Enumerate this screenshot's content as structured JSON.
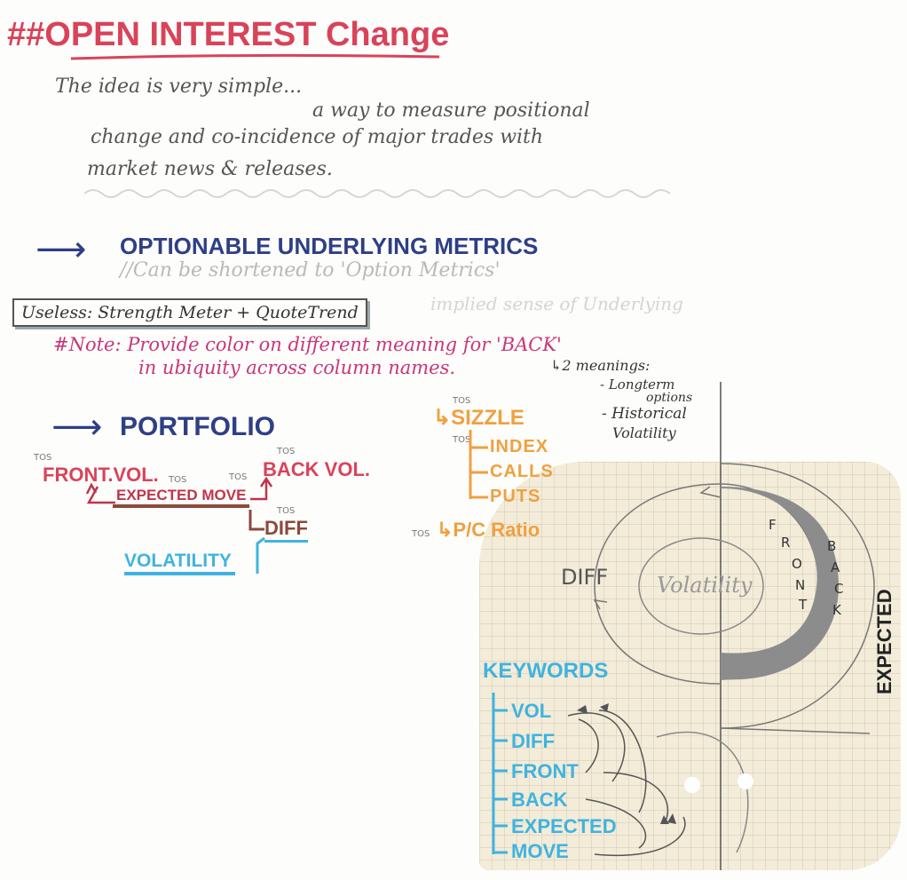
{
  "title": "##OPEN INTEREST Change",
  "intro": {
    "line1": "The idea is very simple...",
    "line2": "a way to measure positional",
    "line3": "change and co-incidence of major trades with",
    "line4": "market news & releases."
  },
  "section1": {
    "arrow": "⟶",
    "heading": "OPTIONABLE UNDERLYING METRICS",
    "note": "//Can be shortened to 'Option Metrics'",
    "faint_note": "implied sense of Underlying",
    "useless_box": "Useless: Strength Meter + QuoteTrend",
    "note2_line1": "#Note: Provide color on different meaning for 'BACK'",
    "note2_line2": "in ubiquity across column names.",
    "meanings_line1": "↳2 meanings:",
    "meanings_line2": "- Longterm",
    "meanings_line3": "options",
    "meanings_line4": "- Historical",
    "meanings_line5": "Volatility"
  },
  "portfolio": {
    "arrow": "⟶",
    "heading": "PORTFOLIO",
    "tos": "TOS",
    "front_vol": "FRONT.VOL.",
    "back_vol": "BACK VOL.",
    "expected_move": "EXPECTED MOVE",
    "diff": "DIFF",
    "volatility": "VOLATILITY"
  },
  "sizzle": {
    "tos": "TOS",
    "items": [
      "↳SIZZLE",
      "INDEX",
      "CALLS",
      "PUTS"
    ],
    "pc_ratio": "↳P/C Ratio"
  },
  "diagram": {
    "diff": "DIFF",
    "volatility": "Volatility",
    "front": [
      "F",
      "R",
      "O",
      "N",
      "T"
    ],
    "back": [
      "B",
      "A",
      "C",
      "K"
    ],
    "expected": "EXPECTED",
    "colors": {
      "paper": "#f3ecd8",
      "shade": "#8c8c8c"
    }
  },
  "keywords": {
    "heading": "KEYWORDS",
    "items": [
      "VOL",
      "DIFF",
      "FRONT",
      "BACK",
      "EXPECTED",
      "MOVE"
    ]
  }
}
